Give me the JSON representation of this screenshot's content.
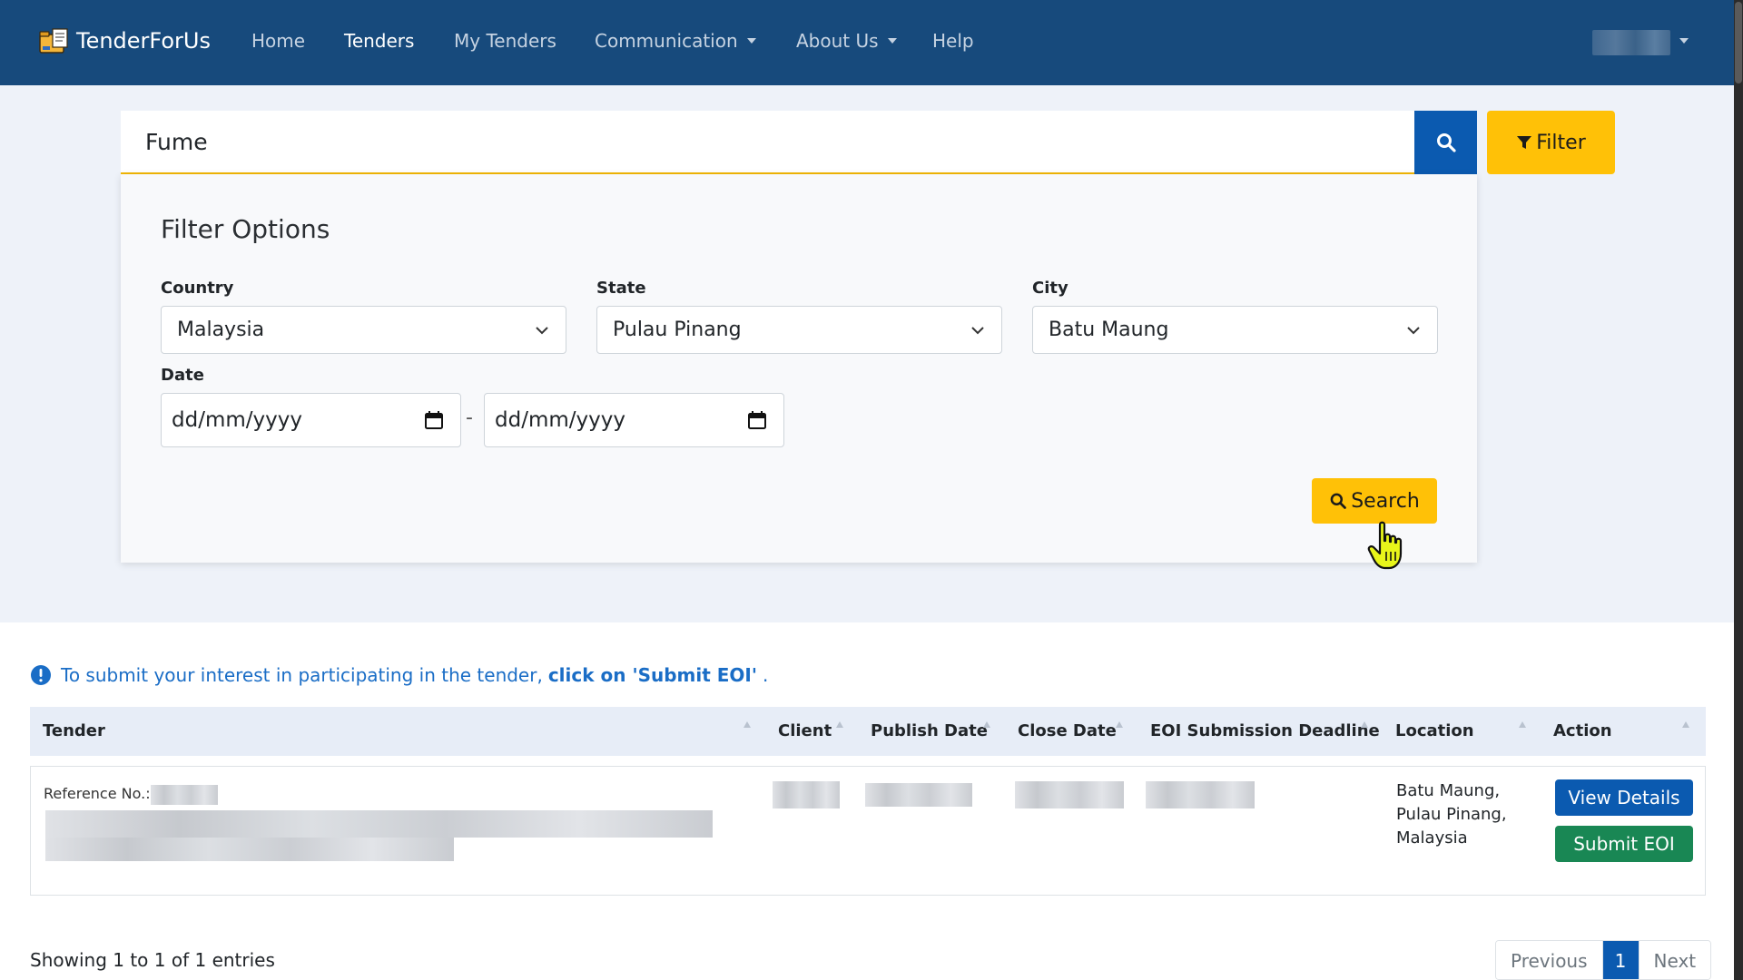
{
  "navbar": {
    "brand": "TenderForUs",
    "links": [
      {
        "label": "Home"
      },
      {
        "label": "Tenders"
      },
      {
        "label": "My Tenders"
      },
      {
        "label": "Communication"
      },
      {
        "label": "About Us"
      },
      {
        "label": "Help"
      }
    ],
    "active": "Tenders"
  },
  "search": {
    "value": "Fume",
    "filter_label": "Filter"
  },
  "filters": {
    "title": "Filter Options",
    "country_label": "Country",
    "country_value": "Malaysia",
    "state_label": "State",
    "state_value": "Pulau Pinang",
    "city_label": "City",
    "city_value": "Batu Maung",
    "date_label": "Date",
    "date_from_placeholder": "dd/mm/yyyy",
    "date_to_placeholder": "dd/mm/yyyy",
    "date_separator": "-",
    "search_label": "Search"
  },
  "info": {
    "text": "To submit your interest in participating in the tender,",
    "strong": "click on 'Submit EOI'",
    "tail": "."
  },
  "table": {
    "headers": [
      "Tender",
      "Client",
      "Publish Date",
      "Close Date",
      "EOI Submission Deadline",
      "Location",
      "Action"
    ],
    "rows": [
      {
        "reference_label": "Reference No.:",
        "location_line1": "Batu Maung,",
        "location_line2": "Pulau Pinang,",
        "location_line3": "Malaysia",
        "view_label": "View Details",
        "eoi_label": "Submit EOI"
      }
    ]
  },
  "footer": {
    "showing": "Showing 1 to 1 of 1 entries",
    "previous": "Previous",
    "page": "1",
    "next": "Next"
  },
  "colors": {
    "navbar": "#174a7c",
    "primary": "#0b5ab0",
    "warning": "#ffc107",
    "success": "#198754",
    "info_text": "#1a6dc6"
  }
}
